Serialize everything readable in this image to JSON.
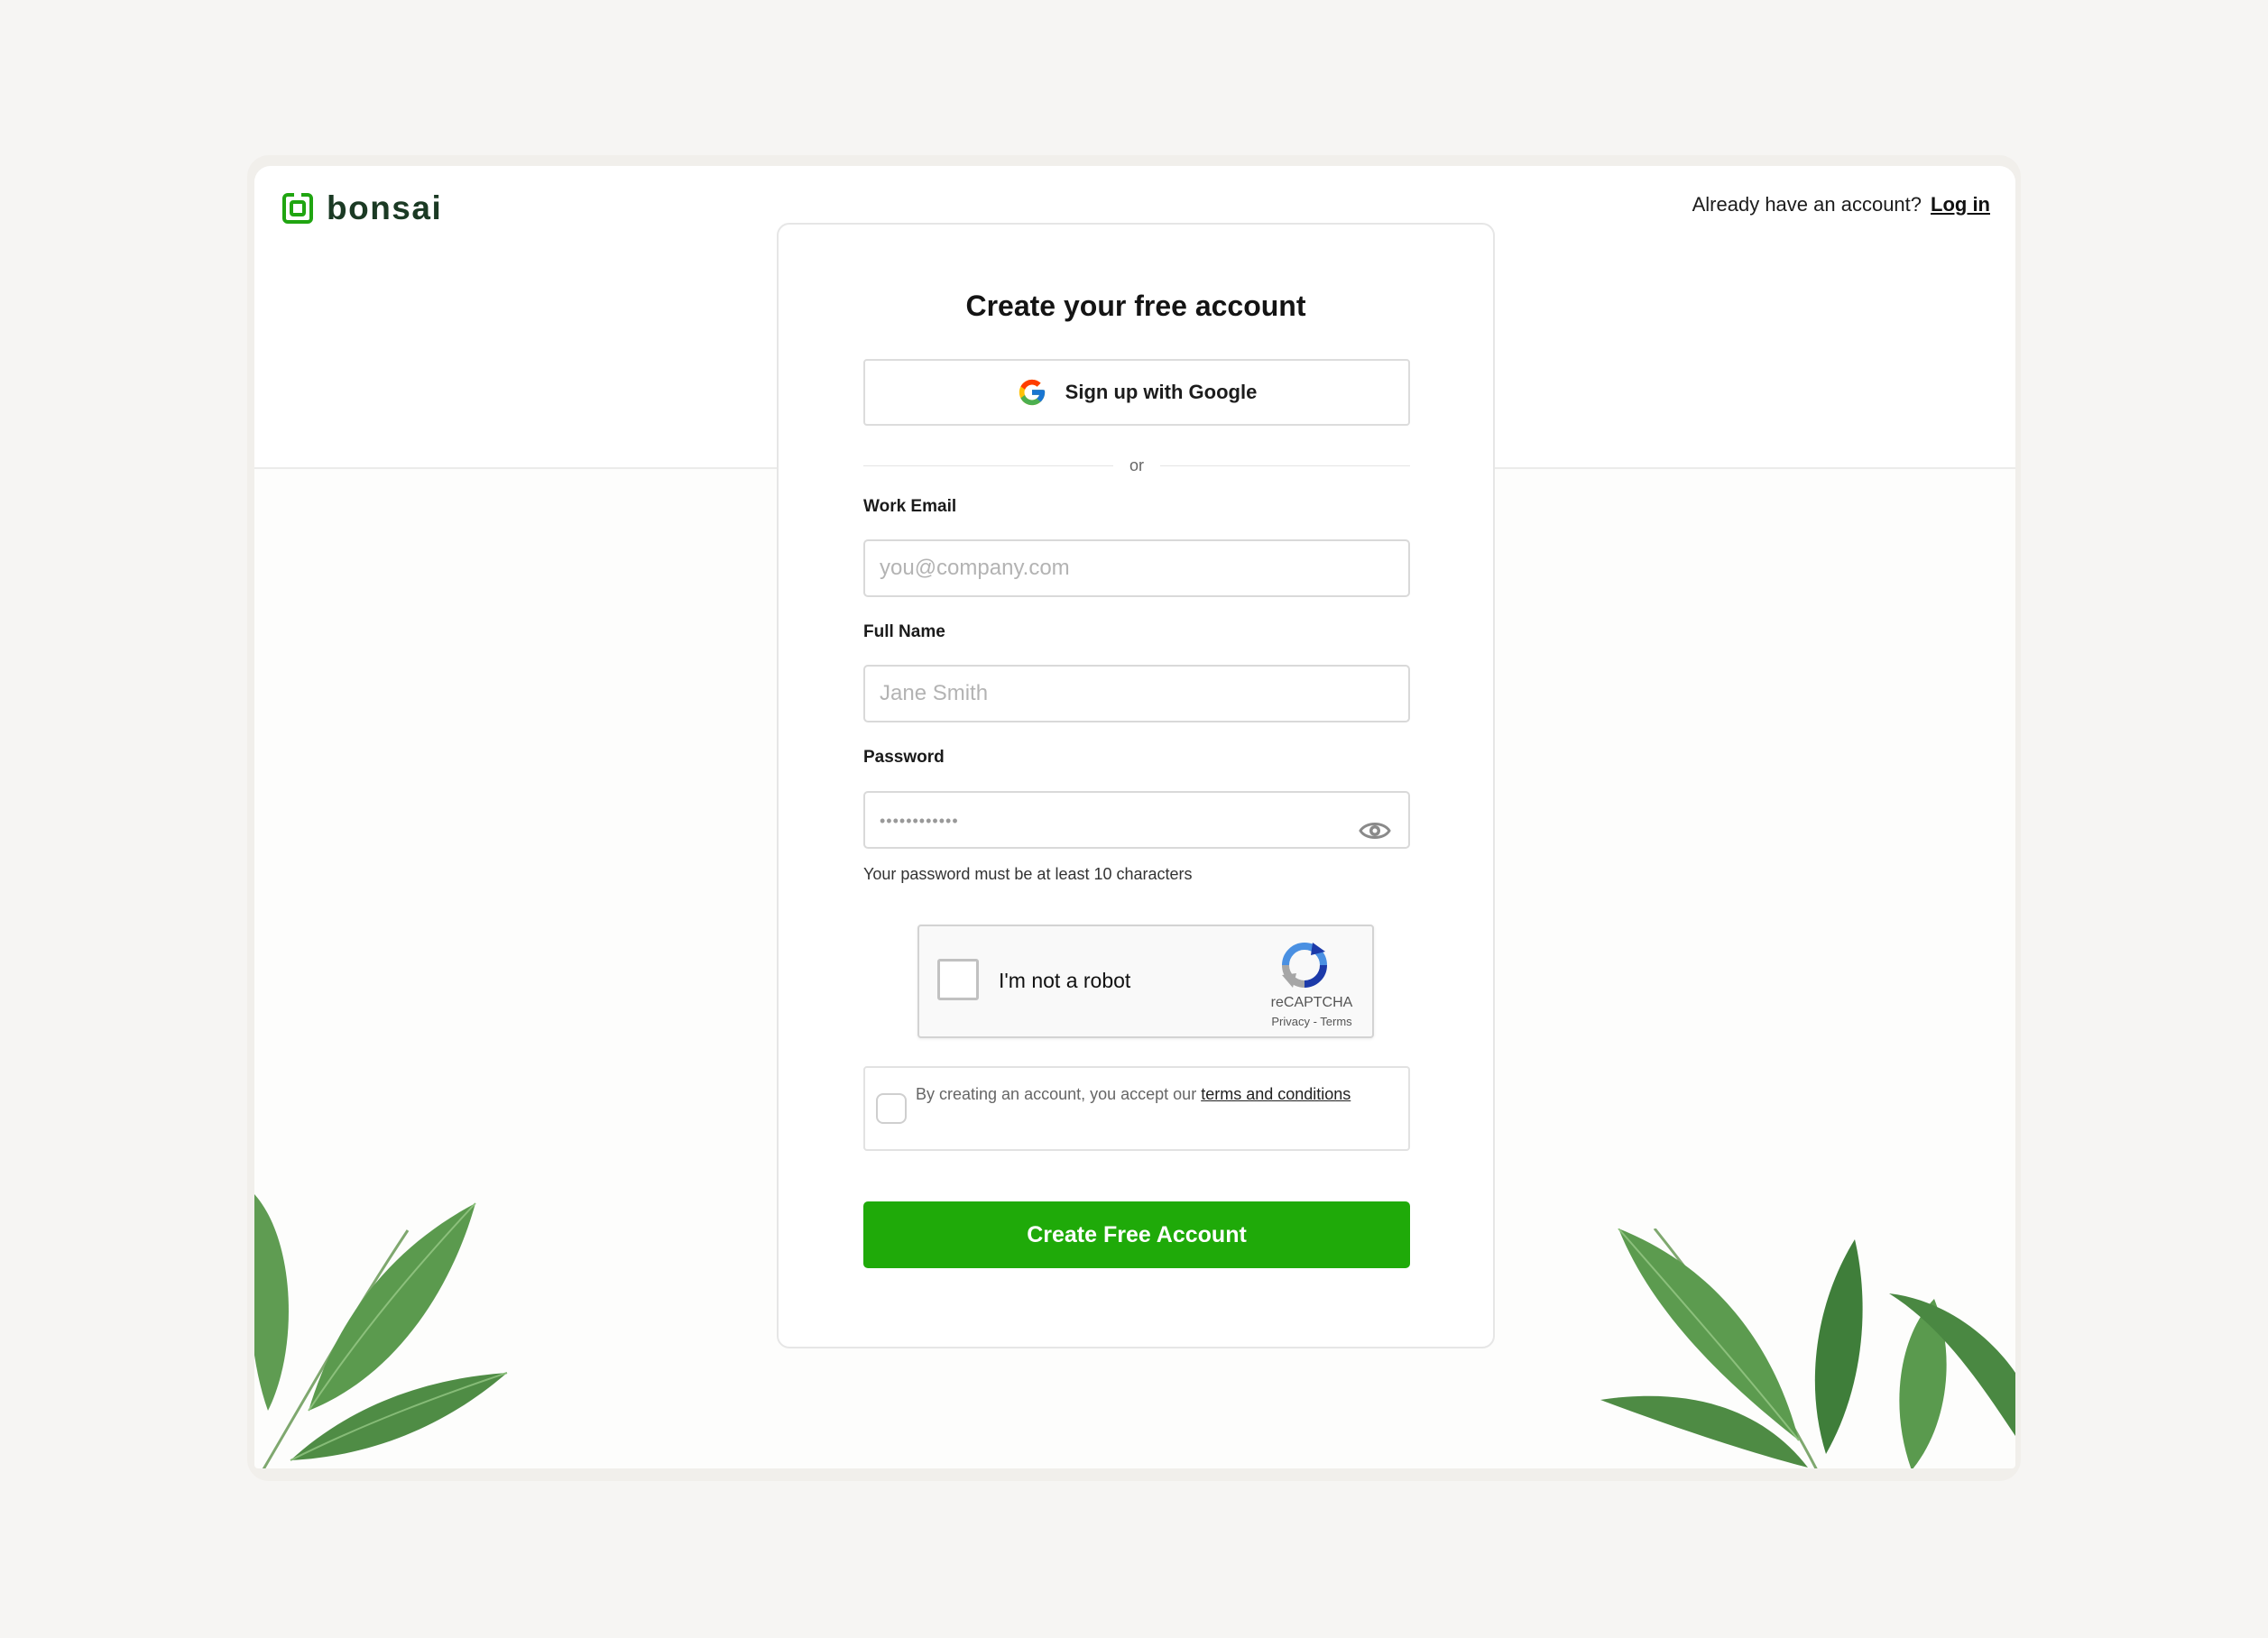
{
  "brand": {
    "name": "bonsai",
    "color": "#20a511",
    "icon": "bonsai-logo-icon"
  },
  "header": {
    "prompt": "Already have an account?",
    "login_link": "Log in"
  },
  "form": {
    "title": "Create your free account",
    "google_button": "Sign up with Google",
    "divider": "or",
    "email": {
      "label": "Work Email",
      "placeholder": "you@company.com",
      "value": ""
    },
    "full_name": {
      "label": "Full Name",
      "placeholder": "Jane Smith",
      "value": ""
    },
    "password": {
      "label": "Password",
      "masked_value": "••••••••••••",
      "hint": "Your password must be at least 10 characters",
      "toggle_icon": "eye-icon"
    },
    "captcha": {
      "label": "I'm not a robot",
      "brand": "reCAPTCHA",
      "privacy": "Privacy",
      "separator": " - ",
      "terms": "Terms",
      "checked": false
    },
    "terms": {
      "text": "By creating an account, you accept our ",
      "link": "terms and conditions",
      "checked": false
    },
    "submit": "Create Free Account"
  },
  "colors": {
    "accent": "#1faa09",
    "leaf": "#5a9a4e"
  }
}
